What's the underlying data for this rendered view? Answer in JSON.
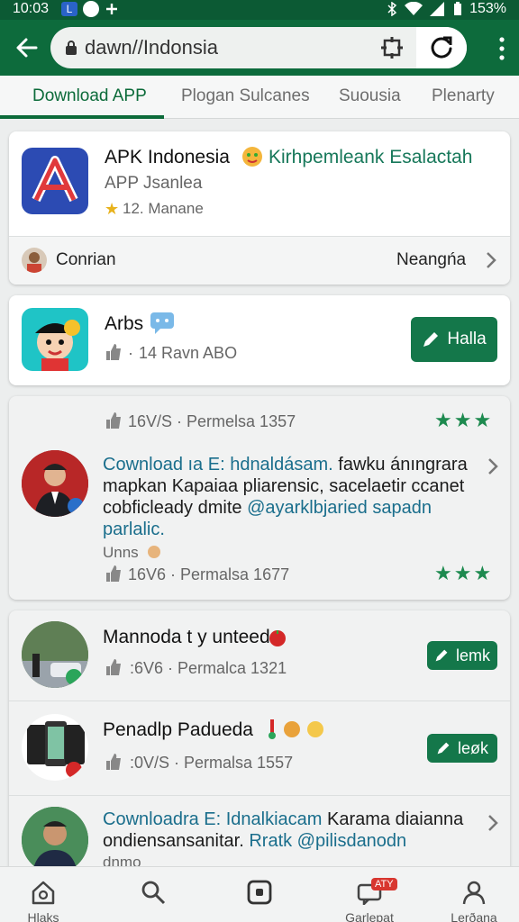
{
  "status_bar": {
    "time": "10:03",
    "battery": "153%"
  },
  "browser": {
    "url": "dawn//Indonsia"
  },
  "tabs": [
    {
      "label": "Download APP",
      "active": true
    },
    {
      "label": "Plogan Sulcanes"
    },
    {
      "label": "Suousia"
    },
    {
      "label": "Plenarty"
    }
  ],
  "app_card": {
    "name": "APK Indonesia",
    "tagline": "Kirhpemleank Esalactah",
    "developer": "APP Jsanlea",
    "rating": "12. Manane",
    "footer_user": "Conrian",
    "footer_action": "Neangńa"
  },
  "arbs_card": {
    "name": "Arbs",
    "meta": "14 Ravn ABO",
    "button": "Halla"
  },
  "post_card": {
    "top_meta": "16V/S · Permelsa 1357",
    "link": "Cownload ıa E: hdnaldásam.",
    "text1": " fawku ánıngrara",
    "text2": "mapkan Kapaiaa pliarensic, sacelaetir ccanet",
    "text3a": "cobficleady dmite ",
    "text3b": "@ayarklbjaried sapadn",
    "text4": "parlalic.",
    "tag": "Unns",
    "bottom_meta": "16V6 · Permalsa 1677",
    "stars": "★★★"
  },
  "list_items": [
    {
      "title": "Mannoda t y unteed",
      "meta": ":6V6 · Permalca 1321",
      "button": "lemk"
    },
    {
      "title": "Penadlp Padueda",
      "meta": ":0V/S · Permalsa 1557",
      "button": "leøk"
    },
    {
      "link": "Cownloadra E: Idnalkiacam",
      "text1": " Karama diaianna",
      "text2a": "ondiensansanitar. ",
      "text2b": "Rratk @pilisdanodn",
      "tag": "dnmo"
    }
  ],
  "bottom_nav": [
    {
      "label": "Hlaks",
      "icon": "home-icon"
    },
    {
      "label": "",
      "icon": "search-icon"
    },
    {
      "label": "",
      "icon": "square-icon"
    },
    {
      "label": "Garlepat",
      "icon": "chat-icon",
      "badge": "ATY"
    },
    {
      "label": "Lerðana",
      "icon": "person-icon"
    }
  ],
  "colors": {
    "primary": "#0d6b3c",
    "accent": "#14774a",
    "link": "#1a6e8c"
  }
}
